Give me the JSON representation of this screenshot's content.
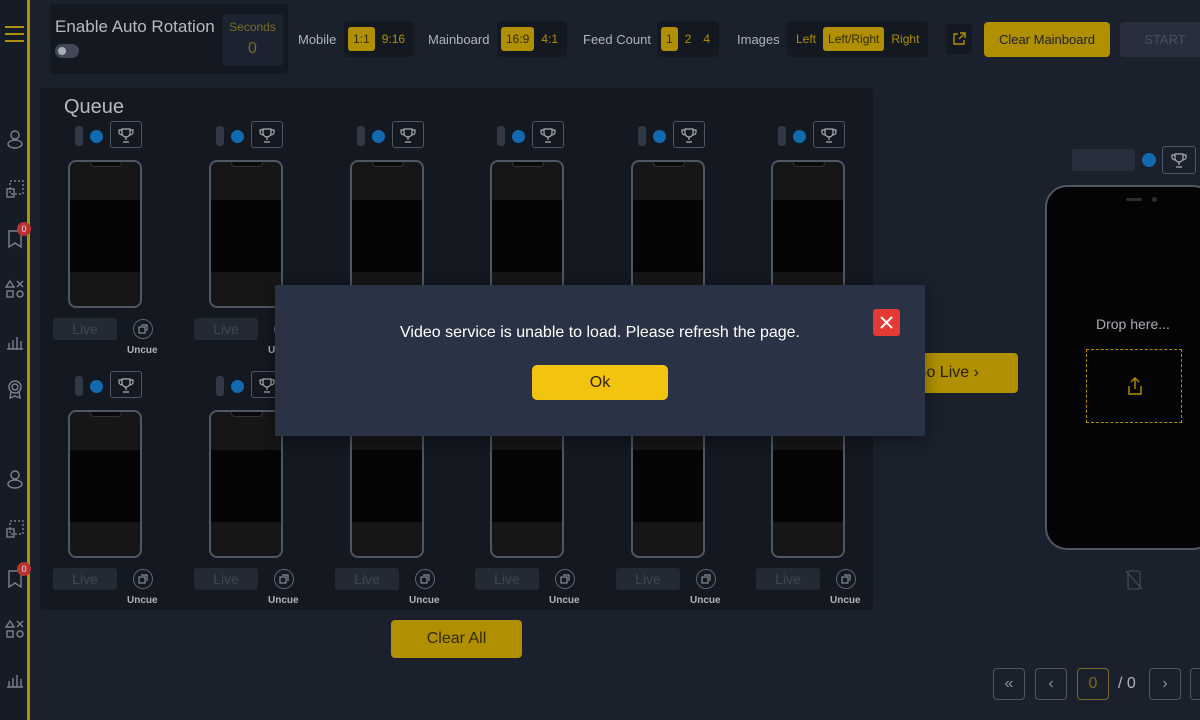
{
  "auto_rotation": {
    "title": "Enable Auto Rotation",
    "seconds_label": "Seconds",
    "seconds_value": "0",
    "enabled": false
  },
  "toolbar": {
    "mobile": {
      "label": "Mobile",
      "options": [
        "1:1",
        "9:16"
      ],
      "selected": "1:1"
    },
    "mainboard": {
      "label": "Mainboard",
      "options": [
        "16:9",
        "4:1"
      ],
      "selected": "16:9"
    },
    "feed_count": {
      "label": "Feed Count",
      "options": [
        "1",
        "2",
        "4"
      ],
      "selected": "1"
    },
    "images": {
      "label": "Images",
      "options": [
        "Left",
        "Left/Right",
        "Right"
      ],
      "selected": "Left/Right"
    },
    "clear_mainboard": "Clear Mainboard",
    "start": "START"
  },
  "sidebar": {
    "badge_1": "0",
    "badge_2": "0"
  },
  "queue": {
    "title": "Queue",
    "live_label": "Live",
    "uncue_label": "Uncue",
    "clear_all": "Clear All"
  },
  "go_live": "Go Live",
  "preview": {
    "drop_text": "Drop here..."
  },
  "pager": {
    "current": "0",
    "total": "/ 0"
  },
  "modal": {
    "message": "Video service is unable to load. Please refresh the page.",
    "ok": "Ok"
  },
  "colors": {
    "accent": "#c9a400",
    "background": "#1e2533",
    "panel": "#161c26",
    "close_red": "#e53935",
    "dot_blue": "#1479c8"
  }
}
